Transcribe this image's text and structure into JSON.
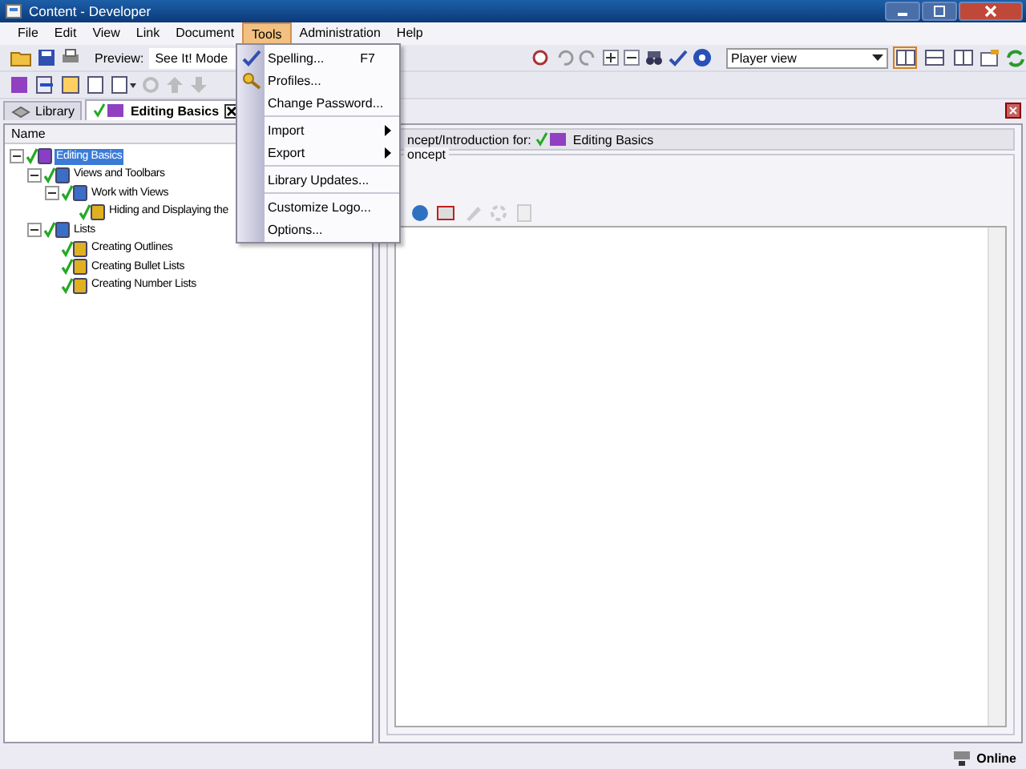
{
  "window": {
    "title": "Content - Developer"
  },
  "menu_bar": [
    {
      "label": "File",
      "selected": false
    },
    {
      "label": "Edit",
      "selected": false
    },
    {
      "label": "View",
      "selected": false
    },
    {
      "label": "Link",
      "selected": false
    },
    {
      "label": "Document",
      "selected": false
    },
    {
      "label": "Tools",
      "selected": true
    },
    {
      "label": "Administration",
      "selected": false
    },
    {
      "label": "Help",
      "selected": false
    }
  ],
  "tools_menu": [
    [
      {
        "label": "Spelling...",
        "shortcut": "F7"
      },
      {
        "label": "Profiles..."
      },
      {
        "label": "Change Password..."
      }
    ],
    [
      {
        "label": "Import",
        "submenu": true
      },
      {
        "label": "Export",
        "submenu": true
      }
    ],
    [
      {
        "label": "Library Updates..."
      }
    ],
    [
      {
        "label": "Customize Logo..."
      },
      {
        "label": "Options..."
      }
    ]
  ],
  "toolbar": {
    "preview_label": "Preview:",
    "preview_mode": "See It! Mode",
    "view_select": "Player view",
    "layout_buttons": [
      {
        "selected": true
      },
      {
        "selected": false
      },
      {
        "selected": false
      }
    ]
  },
  "tabs": [
    {
      "label": "Library",
      "selected": false
    },
    {
      "label": "Editing Basics",
      "selected": true,
      "closable": true
    }
  ],
  "tree": {
    "column": "Name",
    "items": [
      {
        "label": "Editing Basics",
        "kind": "module",
        "selected": true,
        "expanded": true,
        "children": [
          {
            "label": "Views and Toolbars",
            "kind": "section",
            "selected": false,
            "expanded": true,
            "children": [
              {
                "label": "Work with Views",
                "kind": "section",
                "selected": false,
                "expanded": true,
                "children": [
                  {
                    "label": "Hiding and Displaying the",
                    "kind": "topic",
                    "selected": false
                  }
                ]
              }
            ]
          },
          {
            "label": "Lists",
            "kind": "section",
            "selected": false,
            "expanded": true,
            "children": [
              {
                "label": "Creating Outlines",
                "kind": "topic",
                "selected": false
              },
              {
                "label": "Creating Bullet Lists",
                "kind": "topic",
                "selected": false
              },
              {
                "label": "Creating Number Lists",
                "kind": "topic",
                "selected": false
              }
            ]
          }
        ]
      }
    ]
  },
  "editor": {
    "header_label": "ncept/Introduction for:",
    "header_document": "Editing Basics",
    "group_label": "oncept"
  },
  "status_bar": {
    "connection": "Online"
  }
}
